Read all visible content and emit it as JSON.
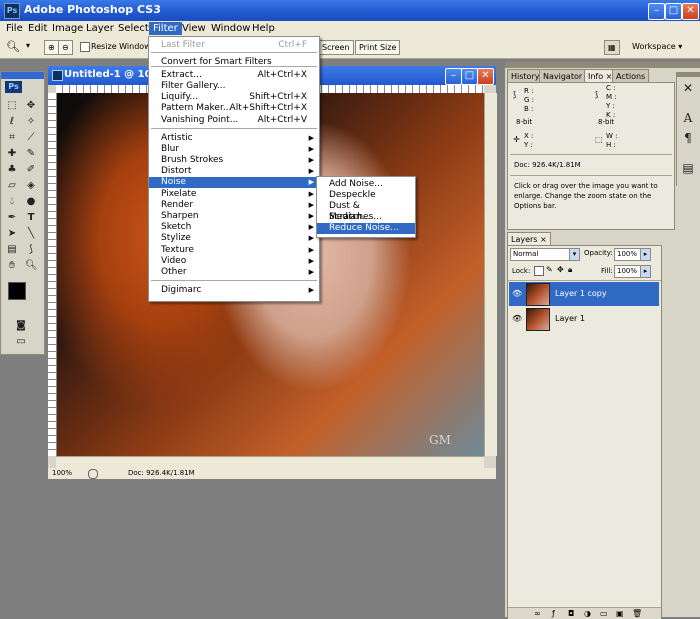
{
  "app": {
    "title": "Adobe Photoshop CS3",
    "logo": "Ps"
  },
  "menubar": [
    "File",
    "Edit",
    "Image",
    "Layer",
    "Select",
    "Filter",
    "View",
    "Window",
    "Help"
  ],
  "options": {
    "resize_windows": "Resize Windows To Fit",
    "screen_btn": "Screen",
    "print_size_btn": "Print Size",
    "workspace": "Workspace ▾"
  },
  "document": {
    "title": "Untitled-1 @ 100",
    "zoom": "100%",
    "doc_info": "Doc: 926.4K/1.81M",
    "watermark": "GM"
  },
  "filter_menu": {
    "items": [
      {
        "label": "Last Filter",
        "shortcut": "Ctrl+F",
        "disabled": true
      },
      {
        "label": "Convert for Smart Filters"
      },
      {
        "label": "Extract...",
        "shortcut": "Alt+Ctrl+X"
      },
      {
        "label": "Filter Gallery..."
      },
      {
        "label": "Liquify...",
        "shortcut": "Shift+Ctrl+X"
      },
      {
        "label": "Pattern Maker...",
        "shortcut": "Alt+Shift+Ctrl+X"
      },
      {
        "label": "Vanishing Point...",
        "shortcut": "Alt+Ctrl+V"
      },
      {
        "label": "Artistic",
        "sub": true
      },
      {
        "label": "Blur",
        "sub": true
      },
      {
        "label": "Brush Strokes",
        "sub": true
      },
      {
        "label": "Distort",
        "sub": true
      },
      {
        "label": "Noise",
        "sub": true
      },
      {
        "label": "Pixelate",
        "sub": true
      },
      {
        "label": "Render",
        "sub": true
      },
      {
        "label": "Sharpen",
        "sub": true
      },
      {
        "label": "Sketch",
        "sub": true
      },
      {
        "label": "Stylize",
        "sub": true
      },
      {
        "label": "Texture",
        "sub": true
      },
      {
        "label": "Video",
        "sub": true
      },
      {
        "label": "Other",
        "sub": true
      },
      {
        "label": "Digimarc",
        "sub": true
      }
    ]
  },
  "noise_menu": {
    "items": [
      "Add Noise...",
      "Despeckle",
      "Dust & Scratches...",
      "Median...",
      "Reduce Noise..."
    ]
  },
  "info_panel": {
    "tabs": [
      "History",
      "Navigator",
      "Info ×",
      "Actions"
    ],
    "left_rgb": [
      "R :",
      "G :",
      "B :"
    ],
    "right_cmyk": [
      "C :",
      "M :",
      "Y :",
      "K :"
    ],
    "bit_left": "8-bit",
    "bit_right": "8-bit",
    "xy": [
      "X :",
      "Y :"
    ],
    "wh": [
      "W :",
      "H :"
    ],
    "doc": "Doc: 926.4K/1.81M",
    "hint": "Click or drag over the image you want to enlarge. Change the zoom state on the Options bar."
  },
  "layers_panel": {
    "tab": "Layers ×",
    "blend_mode": "Normal",
    "opacity_label": "Opacity:",
    "opacity_value": "100%",
    "lock_label": "Lock:",
    "fill_label": "Fill:",
    "fill_value": "100%",
    "layers": [
      {
        "name": "Layer 1 copy",
        "selected": true
      },
      {
        "name": "Layer 1",
        "selected": false
      }
    ]
  },
  "colors": {
    "title_bar": "#2158cf",
    "menu_highlight": "#316ac5",
    "panel_bg": "#d7d4c8"
  }
}
